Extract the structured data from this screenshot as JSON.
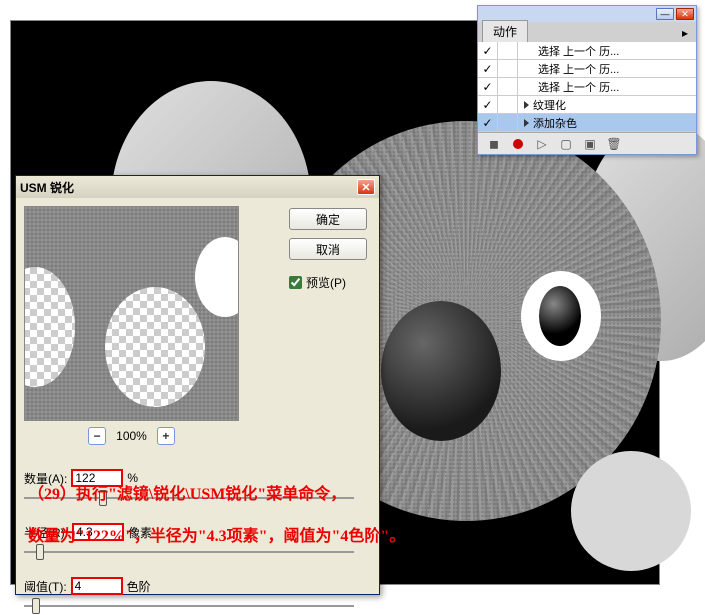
{
  "dialog": {
    "title": "USM 锐化",
    "ok": "确定",
    "cancel": "取消",
    "preview_label": "预览(P)",
    "zoom": "100%",
    "amount_label": "数量(A):",
    "amount_value": "122",
    "amount_unit": "%",
    "radius_label": "半径(R):",
    "radius_value": "4.3",
    "radius_unit": "像素",
    "threshold_label": "阈值(T):",
    "threshold_value": "4",
    "threshold_unit": "色阶"
  },
  "panel": {
    "tab": "动作",
    "rows": [
      {
        "checked": true,
        "indent": 1,
        "name": "选择 上一个 历...",
        "selected": false
      },
      {
        "checked": true,
        "indent": 1,
        "name": "选择 上一个 历...",
        "selected": false
      },
      {
        "checked": true,
        "indent": 1,
        "name": "选择 上一个 历...",
        "selected": false
      },
      {
        "checked": true,
        "indent": 0,
        "name": "纹理化",
        "selected": false,
        "arrow": true
      },
      {
        "checked": true,
        "indent": 0,
        "name": "添加杂色",
        "selected": true,
        "arrow": true
      }
    ]
  },
  "annotation": {
    "line1": "（29）执行\"滤镜\\锐化\\USM锐化\"菜单命令，",
    "line2": "数量为\"122%\"，半径为\"4.3项素\"，阈值为\"4色阶\"。"
  }
}
